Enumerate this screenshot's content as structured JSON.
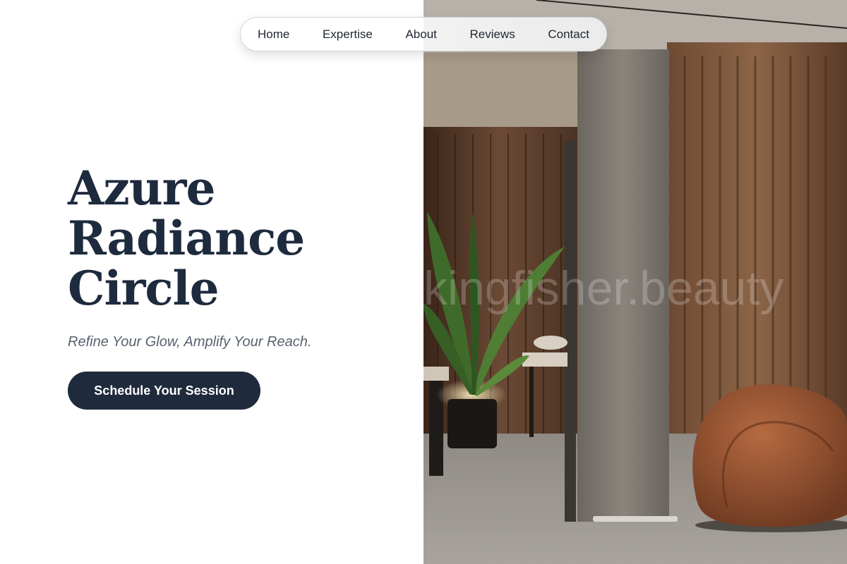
{
  "nav": {
    "items": [
      {
        "label": "Home"
      },
      {
        "label": "Expertise"
      },
      {
        "label": "About"
      },
      {
        "label": "Reviews"
      },
      {
        "label": "Contact"
      }
    ]
  },
  "hero": {
    "title_lines": [
      "Azure",
      "Radiance",
      "Circle"
    ],
    "tagline": "Refine Your Glow, Amplify Your Reach.",
    "cta_label": "Schedule Your Session"
  },
  "photo": {
    "watermark": "kingfisher.beauty"
  }
}
